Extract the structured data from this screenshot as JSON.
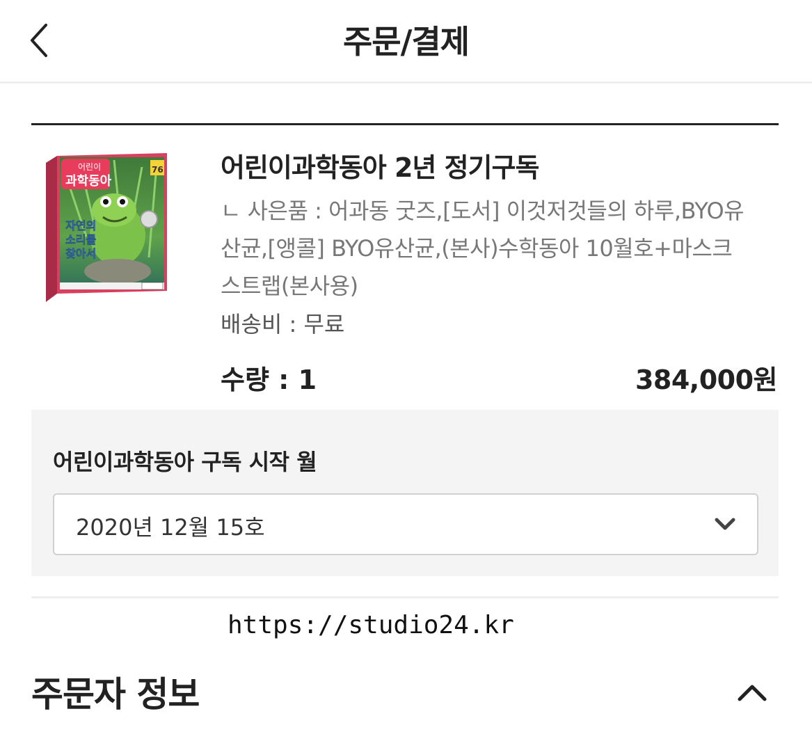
{
  "header": {
    "title": "주문/결제"
  },
  "product": {
    "image_alt": "어린이과학동아 표지",
    "cover": {
      "logo_line1": "어린이",
      "logo_line2": "과학동아",
      "issue_no": "76",
      "headline1": "자연의",
      "headline2": "소리를",
      "headline3": "찾아서"
    },
    "name": "어린이과학동아 2년 정기구독",
    "gift": "ㄴ 사은품 : 어과동 굿즈,[도서] 이것저것들의 하루,BYO유산균,[앵콜] BYO유산균,(본사)수학동아 10월호+마스크스트랩(본사용)",
    "shipping": "배송비 : 무료",
    "quantity": "수량 : 1",
    "price": "384,000원"
  },
  "subscription": {
    "label": "어린이과학동아 구독 시작 월",
    "selected": "2020년 12월 15호"
  },
  "watermark": {
    "url": "https://studio24.kr"
  },
  "orderer": {
    "title": "주문자 정보"
  },
  "colors": {
    "text": "#222222",
    "muted": "#777777",
    "panel": "#f4f4f4",
    "divider": "#eeeeee"
  },
  "icons": {
    "back": "chevron-left-icon",
    "select": "chevron-down-icon",
    "collapse": "chevron-up-icon"
  }
}
